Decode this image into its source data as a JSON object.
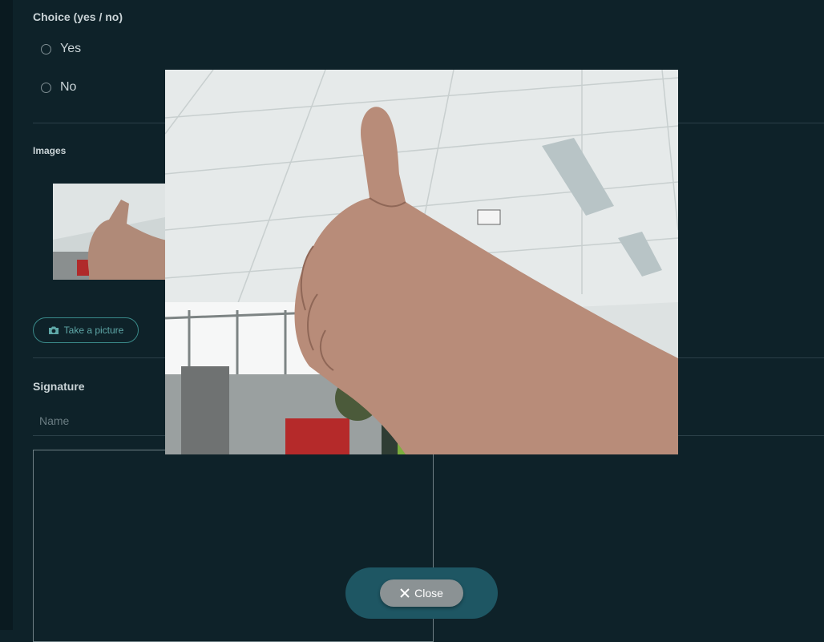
{
  "choice": {
    "title": "Choice (yes / no)",
    "options": [
      "Yes",
      "No"
    ]
  },
  "images": {
    "title": "Images",
    "take_picture_label": "Take a picture"
  },
  "signature": {
    "title": "Signature",
    "name_placeholder": "Name"
  },
  "viewer": {
    "close_label": "Close"
  },
  "colors": {
    "background": "#0e2229",
    "accent": "#3a8a8a",
    "bottom_bar": "#1e5663",
    "close_button": "#8b9294"
  }
}
